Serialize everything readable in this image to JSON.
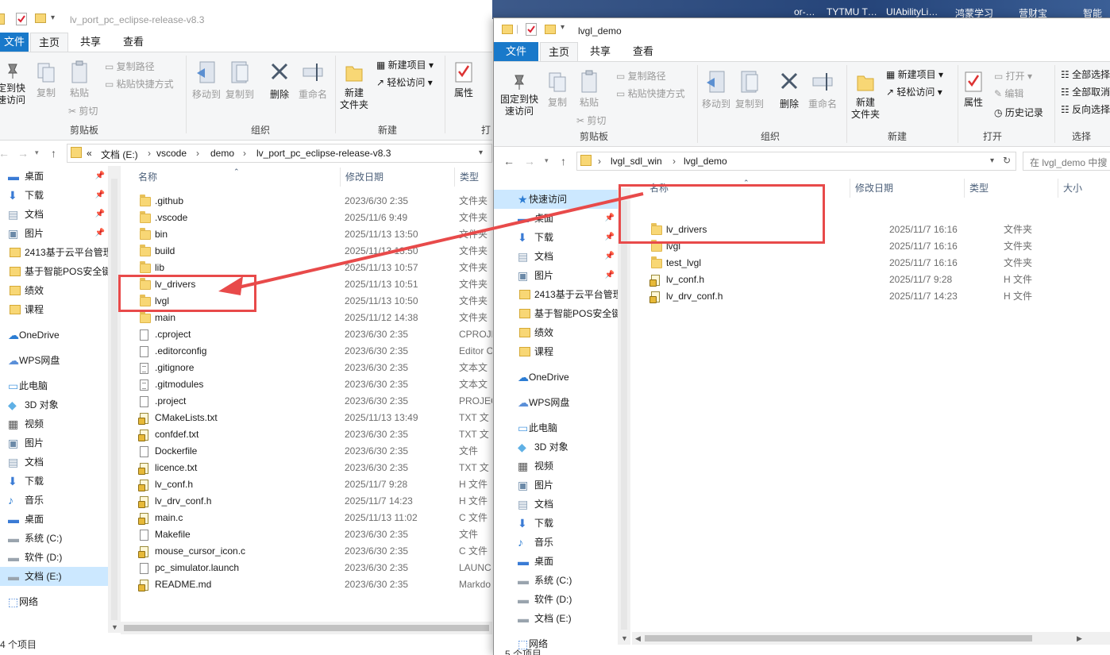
{
  "desktop": {
    "items": [
      "or-…",
      "TYTMU T…",
      "UIAbilityLi…",
      "鸿蒙学习",
      "营财宝",
      "智能"
    ]
  },
  "left": {
    "title": "lv_port_pc_eclipse-release-v8.3",
    "tabs": [
      "文件",
      "主页",
      "共享",
      "查看"
    ],
    "ribbon": {
      "pin_quick": "定到快\n速访问",
      "copy": "复制",
      "paste": "粘贴",
      "copy_path": "复制路径",
      "paste_shortcut": "粘贴快捷方式",
      "cut": "剪切",
      "clipboard": "剪贴板",
      "move_to": "移动到",
      "copy_to": "复制到",
      "delete": "删除",
      "rename": "重命名",
      "organize": "组织",
      "new_folder": "新建\n文件夹",
      "new_item": "新建项目",
      "easy_access": "轻松访问",
      "new_group": "新建",
      "properties": "属性",
      "open_group": "打"
    },
    "breadcrumb": [
      "«",
      "文档 (E:)",
      "vscode",
      "demo",
      "lv_port_pc_eclipse-release-v8.3"
    ],
    "sidebar": [
      {
        "label": "桌面",
        "icon": "desktop-icon",
        "pinned": true
      },
      {
        "label": "下载",
        "icon": "download-icon",
        "pinned": true
      },
      {
        "label": "文档",
        "icon": "document-icon",
        "pinned": true
      },
      {
        "label": "图片",
        "icon": "picture-icon",
        "pinned": true
      },
      {
        "label": "2413基于云平台管理",
        "icon": "folder-icon"
      },
      {
        "label": "基于智能POS安全键",
        "icon": "folder-icon"
      },
      {
        "label": "绩效",
        "icon": "folder-icon"
      },
      {
        "label": "课程",
        "icon": "folder-icon"
      },
      {
        "label": "OneDrive",
        "icon": "cloud-icon"
      },
      {
        "label": "WPS网盘",
        "icon": "wps-cloud-icon"
      },
      {
        "label": "此电脑",
        "icon": "computer-icon"
      },
      {
        "label": "3D 对象",
        "icon": "3d-objects-icon"
      },
      {
        "label": "视频",
        "icon": "video-icon"
      },
      {
        "label": "图片",
        "icon": "picture-icon"
      },
      {
        "label": "文档",
        "icon": "document-icon"
      },
      {
        "label": "下载",
        "icon": "download-icon"
      },
      {
        "label": "音乐",
        "icon": "music-icon"
      },
      {
        "label": "桌面",
        "icon": "desktop-icon"
      },
      {
        "label": "系统 (C:)",
        "icon": "drive-icon"
      },
      {
        "label": "软件 (D:)",
        "icon": "drive-icon"
      },
      {
        "label": "文档 (E:)",
        "icon": "drive-icon",
        "selected": true
      },
      {
        "label": "网络",
        "icon": "network-icon"
      }
    ],
    "columns": [
      "名称",
      "修改日期",
      "类型"
    ],
    "files": [
      {
        "name": ".github",
        "date": "2023/6/30 2:35",
        "type": "文件夹",
        "kind": "folder"
      },
      {
        "name": ".vscode",
        "date": "2025/11/6 9:49",
        "type": "文件夹",
        "kind": "folder"
      },
      {
        "name": "bin",
        "date": "2025/11/13 13:50",
        "type": "文件夹",
        "kind": "folder"
      },
      {
        "name": "build",
        "date": "2025/11/13 13:50",
        "type": "文件夹",
        "kind": "folder"
      },
      {
        "name": "lib",
        "date": "2025/11/13 10:57",
        "type": "文件夹",
        "kind": "folder"
      },
      {
        "name": "lv_drivers",
        "date": "2025/11/13 10:51",
        "type": "文件夹",
        "kind": "folder"
      },
      {
        "name": "lvgl",
        "date": "2025/11/13 10:50",
        "type": "文件夹",
        "kind": "folder"
      },
      {
        "name": "main",
        "date": "2025/11/12 14:38",
        "type": "文件夹",
        "kind": "folder"
      },
      {
        "name": ".cproject",
        "date": "2023/6/30 2:35",
        "type": "CPROJE",
        "kind": "file"
      },
      {
        "name": ".editorconfig",
        "date": "2023/6/30 2:35",
        "type": "Editor C",
        "kind": "file"
      },
      {
        "name": ".gitignore",
        "date": "2023/6/30 2:35",
        "type": "文本文",
        "kind": "txt"
      },
      {
        "name": ".gitmodules",
        "date": "2023/6/30 2:35",
        "type": "文本文",
        "kind": "txt"
      },
      {
        "name": ".project",
        "date": "2023/6/30 2:35",
        "type": "PROJEC",
        "kind": "file"
      },
      {
        "name": "CMakeLists.txt",
        "date": "2025/11/13 13:49",
        "type": "TXT 文",
        "kind": "h"
      },
      {
        "name": "confdef.txt",
        "date": "2023/6/30 2:35",
        "type": "TXT 文",
        "kind": "h"
      },
      {
        "name": "Dockerfile",
        "date": "2023/6/30 2:35",
        "type": "文件",
        "kind": "file"
      },
      {
        "name": "licence.txt",
        "date": "2023/6/30 2:35",
        "type": "TXT 文",
        "kind": "h"
      },
      {
        "name": "lv_conf.h",
        "date": "2025/11/7 9:28",
        "type": "H 文件",
        "kind": "h"
      },
      {
        "name": "lv_drv_conf.h",
        "date": "2025/11/7 14:23",
        "type": "H 文件",
        "kind": "h"
      },
      {
        "name": "main.c",
        "date": "2025/11/13 11:02",
        "type": "C 文件",
        "kind": "h"
      },
      {
        "name": "Makefile",
        "date": "2023/6/30 2:35",
        "type": "文件",
        "kind": "file"
      },
      {
        "name": "mouse_cursor_icon.c",
        "date": "2023/6/30 2:35",
        "type": "C 文件",
        "kind": "h"
      },
      {
        "name": "pc_simulator.launch",
        "date": "2023/6/30 2:35",
        "type": "LAUNC",
        "kind": "file"
      },
      {
        "name": "README.md",
        "date": "2023/6/30 2:35",
        "type": "Markdo",
        "kind": "h"
      }
    ],
    "status": "4 个项目"
  },
  "right": {
    "title": "lvgl_demo",
    "tabs": [
      "文件",
      "主页",
      "共享",
      "查看"
    ],
    "ribbon": {
      "pin_quick": "固定到快\n速访问",
      "copy": "复制",
      "paste": "粘贴",
      "copy_path": "复制路径",
      "paste_shortcut": "粘贴快捷方式",
      "cut": "剪切",
      "clipboard": "剪贴板",
      "move_to": "移动到",
      "copy_to": "复制到",
      "delete": "删除",
      "rename": "重命名",
      "organize": "组织",
      "new_folder": "新建\n文件夹",
      "new_item": "新建项目",
      "easy_access": "轻松访问",
      "new_group": "新建",
      "properties": "属性",
      "open": "打开",
      "edit": "编辑",
      "history": "历史记录",
      "open_group": "打开",
      "select_all": "全部选择",
      "select_none": "全部取消",
      "invert": "反向选择",
      "select_group": "选择"
    },
    "breadcrumb": [
      "lvgl_sdl_win",
      "lvgl_demo"
    ],
    "search_placeholder": "在 lvgl_demo 中搜",
    "sidebar": [
      {
        "label": "快速访问",
        "icon": "star-icon",
        "selected": true
      },
      {
        "label": "桌面",
        "icon": "desktop-icon",
        "pinned": true
      },
      {
        "label": "下载",
        "icon": "download-icon",
        "pinned": true
      },
      {
        "label": "文档",
        "icon": "document-icon",
        "pinned": true
      },
      {
        "label": "图片",
        "icon": "picture-icon",
        "pinned": true
      },
      {
        "label": "2413基于云平台管理",
        "icon": "folder-icon"
      },
      {
        "label": "基于智能POS安全键",
        "icon": "folder-icon"
      },
      {
        "label": "绩效",
        "icon": "folder-icon"
      },
      {
        "label": "课程",
        "icon": "folder-icon"
      },
      {
        "label": "OneDrive",
        "icon": "cloud-icon"
      },
      {
        "label": "WPS网盘",
        "icon": "wps-cloud-icon"
      },
      {
        "label": "此电脑",
        "icon": "computer-icon"
      },
      {
        "label": "3D 对象",
        "icon": "3d-objects-icon"
      },
      {
        "label": "视频",
        "icon": "video-icon"
      },
      {
        "label": "图片",
        "icon": "picture-icon"
      },
      {
        "label": "文档",
        "icon": "document-icon"
      },
      {
        "label": "下载",
        "icon": "download-icon"
      },
      {
        "label": "音乐",
        "icon": "music-icon"
      },
      {
        "label": "桌面",
        "icon": "desktop-icon"
      },
      {
        "label": "系统 (C:)",
        "icon": "drive-icon"
      },
      {
        "label": "软件 (D:)",
        "icon": "drive-icon"
      },
      {
        "label": "文档 (E:)",
        "icon": "drive-icon"
      },
      {
        "label": "网络",
        "icon": "network-icon"
      }
    ],
    "columns": [
      "名称",
      "修改日期",
      "类型",
      "大小"
    ],
    "files": [
      {
        "name": "lv_drivers",
        "date": "2025/11/7 16:16",
        "type": "文件夹",
        "kind": "folder"
      },
      {
        "name": "lvgl",
        "date": "2025/11/7 16:16",
        "type": "文件夹",
        "kind": "folder"
      },
      {
        "name": "test_lvgl",
        "date": "2025/11/7 16:16",
        "type": "文件夹",
        "kind": "folder"
      },
      {
        "name": "lv_conf.h",
        "date": "2025/11/7 9:28",
        "type": "H 文件",
        "kind": "h"
      },
      {
        "name": "lv_drv_conf.h",
        "date": "2025/11/7 14:23",
        "type": "H 文件",
        "kind": "h"
      }
    ],
    "status": "5 个项目"
  },
  "colors": {
    "file_tab": "#1979ca",
    "selection": "#cce8ff",
    "annotation": "#e84a4a"
  }
}
